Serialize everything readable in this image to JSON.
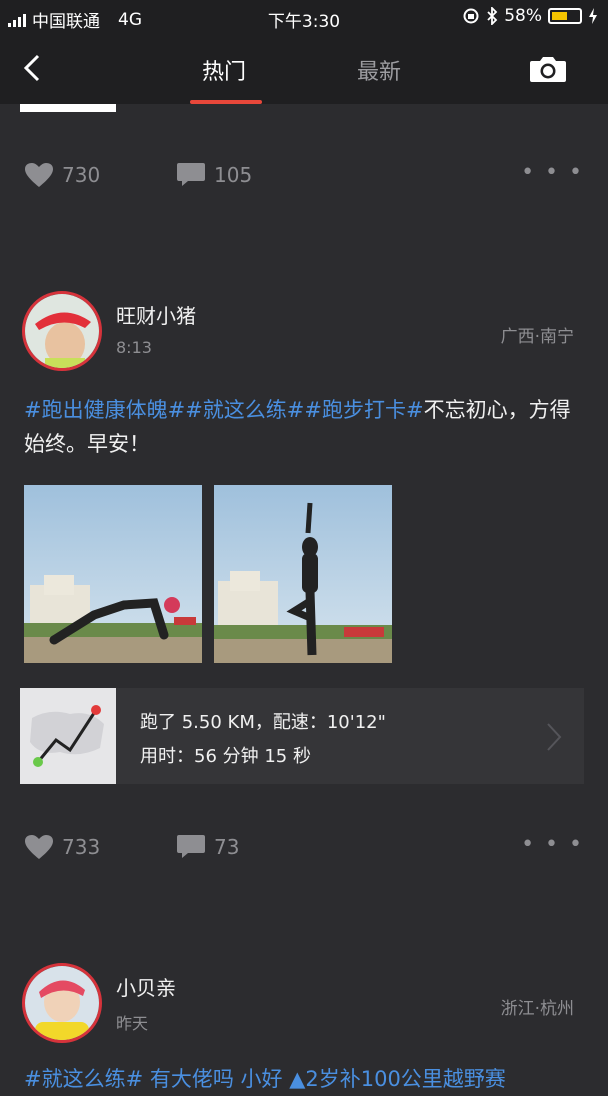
{
  "status_bar": {
    "carrier": "中国联通",
    "network": "4G",
    "time": "下午3:30",
    "battery": "58%",
    "battery_level": 0.58
  },
  "nav": {
    "tabs": [
      {
        "label": "热门"
      },
      {
        "label": "最新"
      }
    ]
  },
  "prev_post": {
    "likes": "730",
    "comments": "105"
  },
  "post1": {
    "username": "旺财小猪",
    "time": "8:13",
    "location": "广西·南宁",
    "tags": [
      "#跑出健康体魄#",
      "#就这么练#",
      "#跑步打卡#"
    ],
    "text": "不忘初心，方得始终。早安！",
    "run": {
      "line1": "跑了 5.50 KM，配速：10'12\"",
      "line2": "用时：56 分钟 15 秒"
    },
    "likes": "733",
    "comments": "73"
  },
  "post2": {
    "username": "小贝亲",
    "time": "昨天",
    "location": "浙江·杭州",
    "text_partial": "#就这么练# 有大佬吗 小好 ▲2岁补100公里越野赛"
  },
  "colors": {
    "background": "#2c2c2f",
    "accent": "#e8473a",
    "hashtag": "#4a8fe0"
  }
}
